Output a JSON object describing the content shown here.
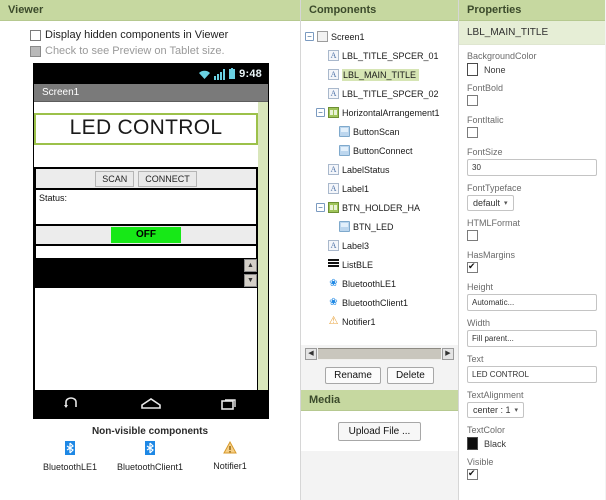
{
  "viewer": {
    "header": "Viewer",
    "checkbox_hidden_label": "Display hidden components in Viewer",
    "checkbox_tablet_label": "Check to see Preview on Tablet size.",
    "phone": {
      "clock": "9:48",
      "screen_title": "Screen1",
      "main_title_text": "LED CONTROL",
      "button_scan": "SCAN",
      "button_connect": "CONNECT",
      "status_text": "Status:",
      "led_button_text": "OFF"
    },
    "nonvisible": {
      "title": "Non-visible components",
      "items": [
        {
          "label": "BluetoothLE1",
          "icon": "bluetooth-icon"
        },
        {
          "label": "BluetoothClient1",
          "icon": "bluetooth-icon"
        },
        {
          "label": "Notifier1",
          "icon": "warning-triangle-icon"
        }
      ]
    }
  },
  "components": {
    "header": "Components",
    "tree": [
      {
        "label": "Screen1",
        "depth": 0,
        "toggle": "minus",
        "icon": "screen-icon",
        "selected": false
      },
      {
        "label": "LBL_TITLE_SPCER_01",
        "depth": 1,
        "toggle": "",
        "icon": "label-icon",
        "selected": false
      },
      {
        "label": "LBL_MAIN_TITLE",
        "depth": 1,
        "toggle": "",
        "icon": "label-icon",
        "selected": true
      },
      {
        "label": "LBL_TITLE_SPCER_02",
        "depth": 1,
        "toggle": "",
        "icon": "label-icon",
        "selected": false
      },
      {
        "label": "HorizontalArrangement1",
        "depth": 1,
        "toggle": "minus",
        "icon": "h-arrange-icon",
        "selected": false
      },
      {
        "label": "ButtonScan",
        "depth": 2,
        "toggle": "",
        "icon": "button-icon",
        "selected": false
      },
      {
        "label": "ButtonConnect",
        "depth": 2,
        "toggle": "",
        "icon": "button-icon",
        "selected": false
      },
      {
        "label": "LabelStatus",
        "depth": 1,
        "toggle": "",
        "icon": "label-icon",
        "selected": false
      },
      {
        "label": "Label1",
        "depth": 1,
        "toggle": "",
        "icon": "label-icon",
        "selected": false
      },
      {
        "label": "BTN_HOLDER_HA",
        "depth": 1,
        "toggle": "minus",
        "icon": "h-arrange-icon",
        "selected": false
      },
      {
        "label": "BTN_LED",
        "depth": 2,
        "toggle": "",
        "icon": "button-icon",
        "selected": false
      },
      {
        "label": "Label3",
        "depth": 1,
        "toggle": "",
        "icon": "label-icon",
        "selected": false
      },
      {
        "label": "ListBLE",
        "depth": 1,
        "toggle": "",
        "icon": "listview-icon",
        "selected": false
      },
      {
        "label": "BluetoothLE1",
        "depth": 1,
        "toggle": "",
        "icon": "bluetooth-icon",
        "selected": false
      },
      {
        "label": "BluetoothClient1",
        "depth": 1,
        "toggle": "",
        "icon": "bluetooth-icon",
        "selected": false
      },
      {
        "label": "Notifier1",
        "depth": 1,
        "toggle": "",
        "icon": "warning-triangle-icon",
        "selected": false
      }
    ],
    "rename_label": "Rename",
    "delete_label": "Delete"
  },
  "media": {
    "header": "Media",
    "upload_label": "Upload File ..."
  },
  "properties": {
    "header": "Properties",
    "component_name": "LBL_MAIN_TITLE",
    "items": [
      {
        "name": "BackgroundColor",
        "type": "color",
        "value": "None",
        "swatch": "#ffffff"
      },
      {
        "name": "FontBold",
        "type": "checkbox",
        "checked": false
      },
      {
        "name": "FontItalic",
        "type": "checkbox",
        "checked": false
      },
      {
        "name": "FontSize",
        "type": "input",
        "value": "30"
      },
      {
        "name": "FontTypeface",
        "type": "select",
        "value": "default"
      },
      {
        "name": "HTMLFormat",
        "type": "checkbox",
        "checked": false
      },
      {
        "name": "HasMargins",
        "type": "checkbox",
        "checked": true
      },
      {
        "name": "Height",
        "type": "input",
        "value": "Automatic..."
      },
      {
        "name": "Width",
        "type": "input",
        "value": "Fill parent..."
      },
      {
        "name": "Text",
        "type": "input",
        "value": "LED CONTROL"
      },
      {
        "name": "TextAlignment",
        "type": "select",
        "value": "center : 1"
      },
      {
        "name": "TextColor",
        "type": "color",
        "value": "Black",
        "swatch": "#0d0d0d"
      },
      {
        "name": "Visible",
        "type": "checkbox",
        "checked": true
      }
    ]
  },
  "colors": {
    "panel_header": "#c6d8a0",
    "selection": "#d6e5b4",
    "led_green": "#17e817",
    "title_border": "#9cc14a"
  }
}
